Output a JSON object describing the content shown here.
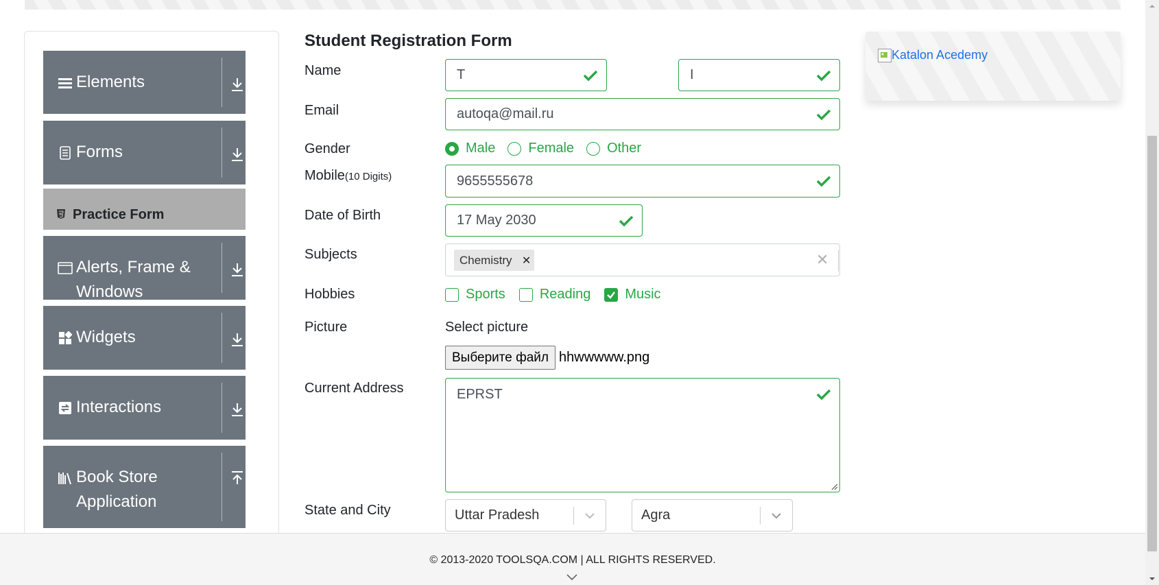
{
  "sidebar": {
    "groups": [
      {
        "title": "Elements",
        "icon": "menu-icon",
        "arrow": "down"
      },
      {
        "title": "Forms",
        "icon": "document-icon",
        "arrow": "down"
      },
      {
        "title": "Alerts, Frame &",
        "title2": "Windows",
        "icon": "window-icon",
        "arrow": "down"
      },
      {
        "title": "Widgets",
        "icon": "widgets-icon",
        "arrow": "down"
      },
      {
        "title": "Interactions",
        "icon": "interactions-icon",
        "arrow": "down"
      },
      {
        "title": "Book Store",
        "title2": "Application",
        "icon": "books-icon",
        "arrow": "up"
      }
    ],
    "active_item": "Practice Form"
  },
  "form": {
    "title": "Student Registration Form",
    "labels": {
      "name": "Name",
      "email": "Email",
      "gender": "Gender",
      "mobile": "Mobile",
      "mobile_hint": "(10 Digits)",
      "dob": "Date of Birth",
      "subjects": "Subjects",
      "hobbies": "Hobbies",
      "picture": "Picture",
      "address": "Current Address",
      "state_city": "State and City"
    },
    "first_name": "T",
    "last_name": "I",
    "email": "autoqa@mail.ru",
    "gender_options": [
      "Male",
      "Female",
      "Other"
    ],
    "gender_selected": "Male",
    "mobile": "9655555678",
    "dob": "17 May 2030",
    "subjects": [
      "Chemistry"
    ],
    "hobbies": [
      {
        "label": "Sports",
        "checked": false
      },
      {
        "label": "Reading",
        "checked": false
      },
      {
        "label": "Music",
        "checked": true
      }
    ],
    "select_picture_label": "Select picture",
    "file_button": "Выберите файл",
    "file_name": "hhwwwww.png",
    "address": "EPRST",
    "state": "Uttar Pradesh",
    "city": "Agra"
  },
  "ad": {
    "alt_text": "Katalon Acedemy"
  },
  "footer": {
    "copyright": "© 2013-2020 TOOLSQA.COM | ALL RIGHTS RESERVED."
  },
  "colors": {
    "valid": "#28a745",
    "sidebar": "#6c757d",
    "active": "#adadad"
  }
}
